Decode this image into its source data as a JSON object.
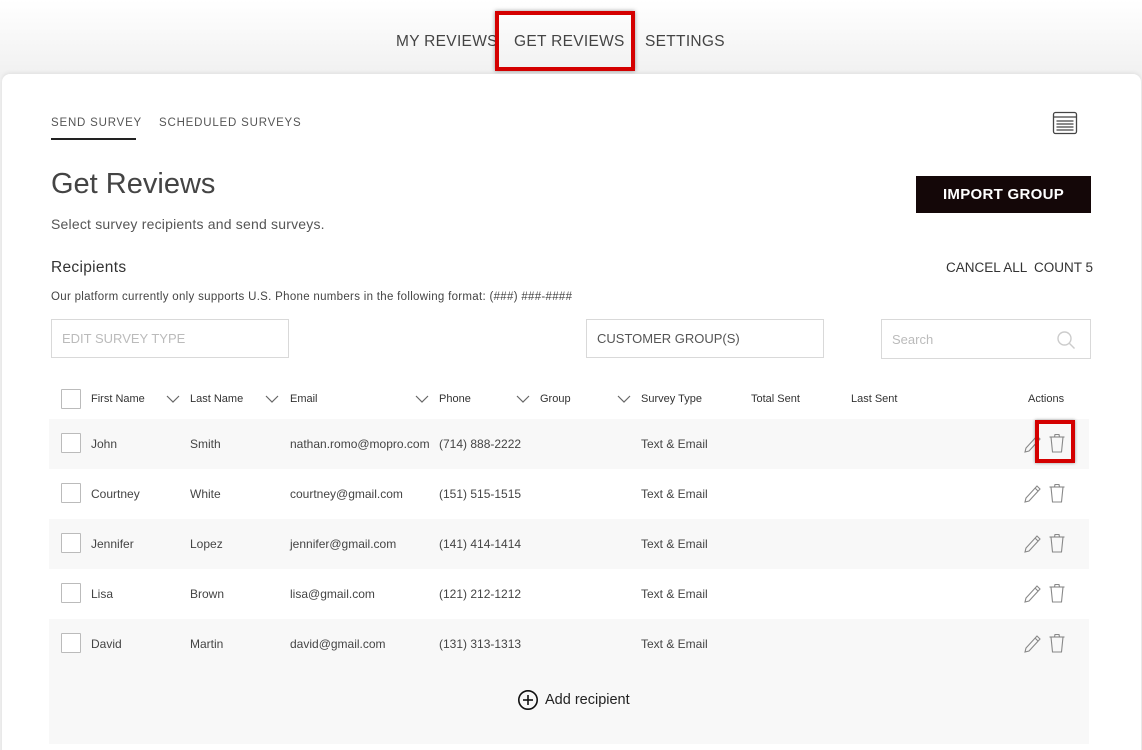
{
  "top_nav": {
    "tabs": [
      {
        "label": "MY REVIEWS"
      },
      {
        "label": "GET REVIEWS"
      },
      {
        "label": "SETTINGS"
      }
    ]
  },
  "sub_tabs": [
    {
      "label": "SEND SURVEY"
    },
    {
      "label": "SCHEDULED SURVEYS"
    }
  ],
  "page": {
    "title": "Get Reviews",
    "subtitle": "Select survey recipients and send surveys.",
    "import_button": "IMPORT GROUP"
  },
  "recipients": {
    "title": "Recipients",
    "cancel_all": "CANCEL ALL",
    "count": "COUNT 5",
    "note": "Our platform currently only supports U.S. Phone numbers in the following format: (###) ###-####"
  },
  "filters": {
    "survey_type": "EDIT SURVEY TYPE",
    "customer_groups": "CUSTOMER GROUP(S)",
    "search_placeholder": "Search"
  },
  "table": {
    "headers": {
      "first_name": "First Name",
      "last_name": "Last Name",
      "email": "Email",
      "phone": "Phone",
      "group": "Group",
      "survey_type": "Survey Type",
      "total_sent": "Total Sent",
      "last_sent": "Last Sent",
      "actions": "Actions"
    },
    "rows": [
      {
        "first": "John",
        "last": "Smith",
        "email": "nathan.romo@mopro.com",
        "phone": "(714) 888-2222",
        "group": "",
        "survey": "Text & Email",
        "total": "",
        "last_sent": ""
      },
      {
        "first": "Courtney",
        "last": "White",
        "email": "courtney@gmail.com",
        "phone": "(151) 515-1515",
        "group": "",
        "survey": "Text & Email",
        "total": "",
        "last_sent": ""
      },
      {
        "first": "Jennifer",
        "last": "Lopez",
        "email": "jennifer@gmail.com",
        "phone": "(141) 414-1414",
        "group": "",
        "survey": "Text & Email",
        "total": "",
        "last_sent": ""
      },
      {
        "first": "Lisa",
        "last": "Brown",
        "email": "lisa@gmail.com",
        "phone": "(121) 212-1212",
        "group": "",
        "survey": "Text & Email",
        "total": "",
        "last_sent": ""
      },
      {
        "first": "David",
        "last": "Martin",
        "email": "david@gmail.com",
        "phone": "(131) 313-1313",
        "group": "",
        "survey": "Text & Email",
        "total": "",
        "last_sent": ""
      }
    ],
    "add_recipient": "Add recipient"
  },
  "icons": {
    "search": "search-icon",
    "edit": "pencil-icon",
    "delete": "trash-icon",
    "add": "plus-circle-icon",
    "layout": "window-icon"
  },
  "colors": {
    "highlight": "#d40000",
    "button": "#140708"
  }
}
